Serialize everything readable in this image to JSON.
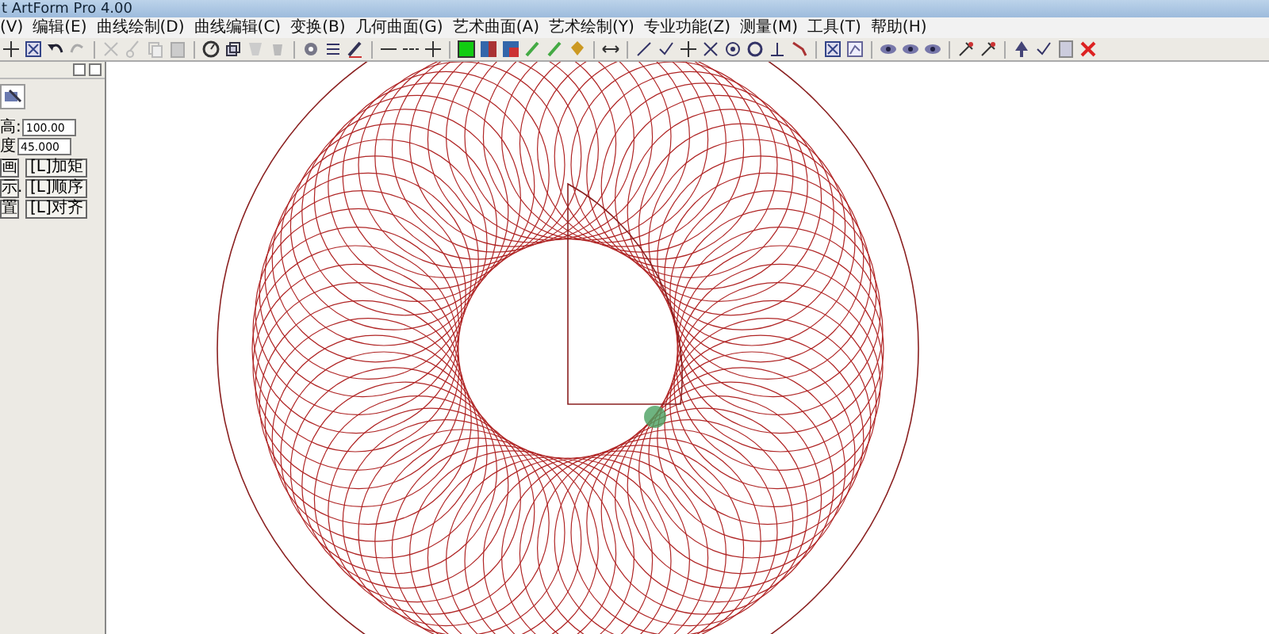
{
  "window": {
    "title": "t ArtForm Pro 4.00"
  },
  "menu": [
    {
      "label": "(V)"
    },
    {
      "label": "编辑(E)"
    },
    {
      "label": "曲线绘制(D)"
    },
    {
      "label": "曲线编辑(C)"
    },
    {
      "label": "变换(B)"
    },
    {
      "label": "几何曲面(G)"
    },
    {
      "label": "艺术曲面(A)"
    },
    {
      "label": "艺术绘制(Y)"
    },
    {
      "label": "专业功能(Z)"
    },
    {
      "label": "测量(M)"
    },
    {
      "label": "工具(T)"
    },
    {
      "label": "帮助(H)"
    }
  ],
  "panel": {
    "fields": [
      {
        "label": "高:",
        "value": "100.00"
      },
      {
        "label": "度",
        "value": "45.000"
      }
    ],
    "buttons": [
      [
        "画",
        "[L]加矩"
      ],
      [
        "示.",
        "[L]顺序"
      ],
      [
        "置",
        "[L]对齐"
      ]
    ]
  }
}
